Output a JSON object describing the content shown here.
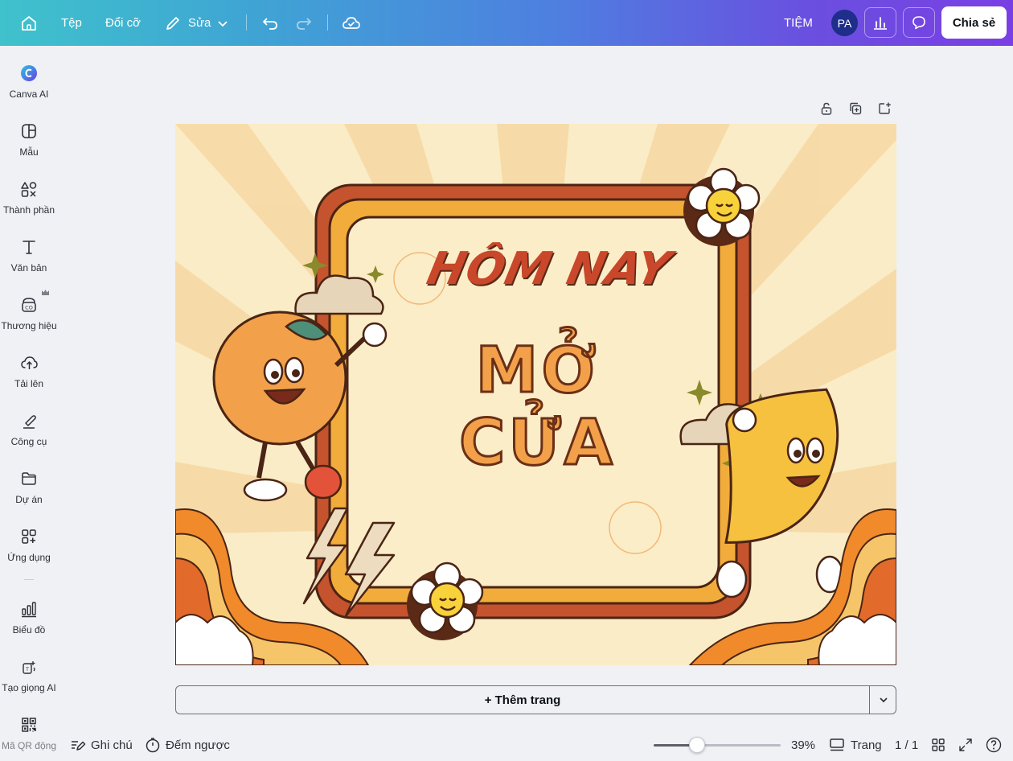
{
  "topbar": {
    "file": "Tệp",
    "resize": "Đổi cỡ",
    "edit": "Sửa",
    "brand": "TIỆM",
    "avatar": "PA",
    "share": "Chia sẻ"
  },
  "sidebar": {
    "items": [
      {
        "label": "Canva AI",
        "icon": "canva-ai-icon"
      },
      {
        "label": "Mẫu",
        "icon": "templates-icon"
      },
      {
        "label": "Thành phần",
        "icon": "elements-icon"
      },
      {
        "label": "Văn bản",
        "icon": "text-icon"
      },
      {
        "label": "Thương hiệu",
        "icon": "brand-icon"
      },
      {
        "label": "Tải lên",
        "icon": "upload-icon"
      },
      {
        "label": "Công cụ",
        "icon": "tools-icon"
      },
      {
        "label": "Dự án",
        "icon": "projects-icon"
      },
      {
        "label": "Ứng dụng",
        "icon": "apps-icon"
      },
      {
        "label": "Biểu đồ",
        "icon": "charts-icon"
      },
      {
        "label": "Tạo giọng AI",
        "icon": "ai-voice-icon"
      },
      {
        "label": "Mã QR động",
        "icon": "qr-code-icon"
      }
    ]
  },
  "design": {
    "title_line1": "HÔM NAY",
    "title_line2": "MỞ CỬA"
  },
  "canvas": {
    "add_page": "+ Thêm trang"
  },
  "bottombar": {
    "notes": "Ghi chú",
    "timer": "Đếm ngược",
    "zoom_value": 39,
    "zoom_label": "39%",
    "pages_label": "Trang",
    "page_count": "1 / 1"
  },
  "colors": {
    "accent_gradient_start": "#3fc2cc",
    "accent_gradient_end": "#7a3fe4",
    "canvas_bg": "#faecc6"
  }
}
